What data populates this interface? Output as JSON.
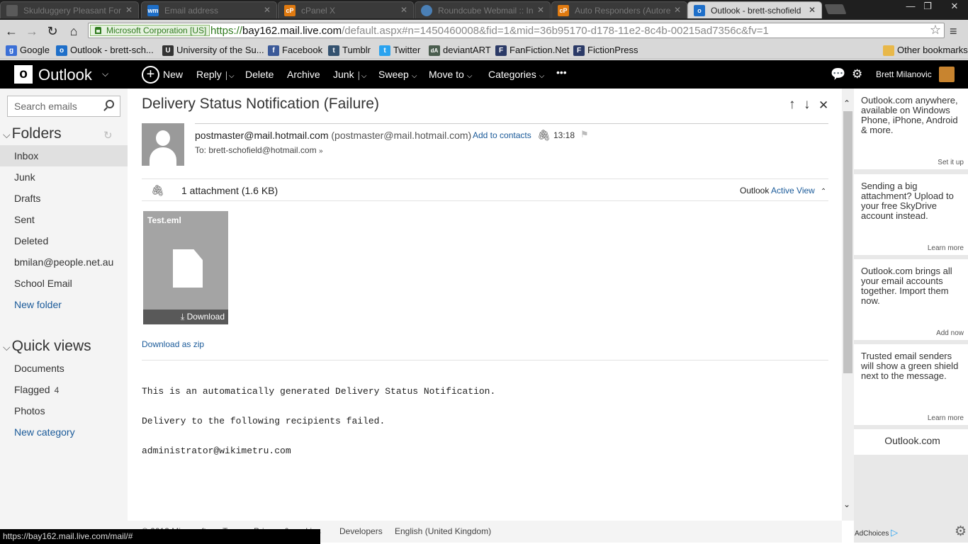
{
  "browser": {
    "tabs": [
      {
        "title": "Skulduggery Pleasant For",
        "icon": "forum-icon",
        "color": "#5a5a5a",
        "glyph": ""
      },
      {
        "title": "Email address",
        "icon": "wm-icon",
        "color": "#1e6fc9",
        "glyph": "wm"
      },
      {
        "title": "cPanel X",
        "icon": "cpanel-icon",
        "color": "#e07a10",
        "glyph": "cP"
      },
      {
        "title": "Roundcube Webmail :: In",
        "icon": "roundcube-icon",
        "color": "#4a7fb5",
        "glyph": ""
      },
      {
        "title": "Auto Responders (Autore",
        "icon": "cpanel-icon",
        "color": "#e07a10",
        "glyph": "cP"
      },
      {
        "title": "Outlook - brett-schofield",
        "icon": "outlook-icon",
        "color": "#1e6fc9",
        "glyph": "o"
      }
    ],
    "ev_label": "Microsoft Corporation [US]",
    "url_proto": "https://",
    "url_host": "bay162.mail.live.com",
    "url_path": "/default.aspx#n=1450460008&fid=1&mid=36b95170-d178-11e2-8c4b-00215ad7356c&fv=1",
    "bookmarks": [
      {
        "label": "Google",
        "icon": "google-icon",
        "color": "#3b6fd6",
        "glyph": "g"
      },
      {
        "label": "Outlook - brett-sch...",
        "icon": "outlook-icon",
        "color": "#1e6fc9",
        "glyph": "o"
      },
      {
        "label": "University of the Su...",
        "icon": "university-icon",
        "color": "#333",
        "glyph": "U"
      },
      {
        "label": "Facebook",
        "icon": "facebook-icon",
        "color": "#3b5998",
        "glyph": "f"
      },
      {
        "label": "Tumblr",
        "icon": "tumblr-icon",
        "color": "#34526f",
        "glyph": "t"
      },
      {
        "label": "Twitter",
        "icon": "twitter-icon",
        "color": "#2aa3ef",
        "glyph": "t"
      },
      {
        "label": "deviantART",
        "icon": "deviantart-icon",
        "color": "#4a5d4e",
        "glyph": "dA"
      },
      {
        "label": "FanFiction.Net",
        "icon": "fanfiction-icon",
        "color": "#2b3a67",
        "glyph": "F"
      },
      {
        "label": "FictionPress",
        "icon": "fictionpress-icon",
        "color": "#2b3a67",
        "glyph": "F"
      }
    ],
    "other_bookmarks": "Other bookmarks",
    "status_url": "https://bay162.mail.live.com/mail/#"
  },
  "header": {
    "logo": "Outlook",
    "commands": {
      "new": "New",
      "reply": "Reply",
      "delete": "Delete",
      "archive": "Archive",
      "junk": "Junk",
      "sweep": "Sweep",
      "move_to": "Move to",
      "categories": "Categories",
      "more": "•••"
    },
    "user": "Brett Milanovic"
  },
  "sidebar": {
    "search_placeholder": "Search emails",
    "folders_title": "Folders",
    "folders": [
      {
        "label": "Inbox",
        "selected": true
      },
      {
        "label": "Junk"
      },
      {
        "label": "Drafts"
      },
      {
        "label": "Sent"
      },
      {
        "label": "Deleted"
      },
      {
        "label": "bmilan@people.net.au"
      },
      {
        "label": "School Email"
      }
    ],
    "new_folder": "New folder",
    "quick_views_title": "Quick views",
    "quick_views": [
      {
        "label": "Documents"
      },
      {
        "label": "Flagged",
        "count": "4"
      },
      {
        "label": "Photos"
      }
    ],
    "new_category": "New category"
  },
  "message": {
    "subject": "Delivery Status Notification (Failure)",
    "from_name": "postmaster@mail.hotmail.com",
    "from_addr": "(postmaster@mail.hotmail.com)",
    "add_to_contacts": "Add to contacts",
    "time": "13:18",
    "to_label": "To:",
    "to": "brett-schofield@hotmail.com",
    "attachment_count": "1 attachment (1.6 KB)",
    "active_view_prefix": "Outlook",
    "active_view_link": "Active View",
    "attachment": {
      "name": "Test.eml",
      "download": "Download"
    },
    "download_zip": "Download as zip",
    "body": [
      "This is an automatically generated Delivery Status Notification.",
      "Delivery to the following recipients failed.",
      "administrator@wikimetru.com"
    ]
  },
  "footer": {
    "copyright": "© 2013 Microsoft",
    "terms": "Terms",
    "privacy": "Privacy & cookies",
    "developers": "Developers",
    "language": "English (United Kingdom)"
  },
  "rail": {
    "cards": [
      {
        "text": "Outlook.com anywhere, available on Windows Phone, iPhone, Android & more.",
        "action": "Set it up"
      },
      {
        "text": "Sending a big attachment? Upload to your free SkyDrive account instead.",
        "action": "Learn more"
      },
      {
        "text": "Outlook.com brings all your email accounts together. Import them now.",
        "action": "Add now"
      },
      {
        "text": "Trusted email senders will show a green shield next to the message.",
        "action": "Learn more"
      }
    ],
    "brand_card": "Outlook.com",
    "adchoices": "AdChoices"
  }
}
